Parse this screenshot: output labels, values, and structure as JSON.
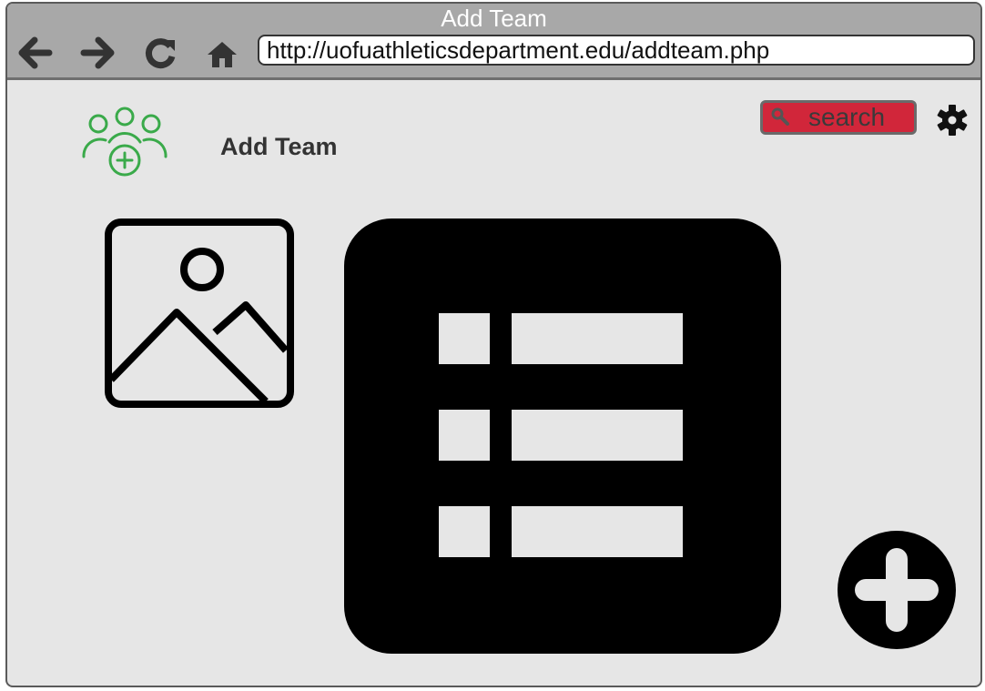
{
  "browser": {
    "window_title": "Add Team",
    "url": "http://uofuathleticsdepartment.edu/addteam.php",
    "nav_icons": [
      "back-arrow-icon",
      "forward-arrow-icon",
      "reload-icon",
      "home-icon"
    ]
  },
  "header": {
    "title": "Add Team",
    "logo_icon": "team-add-icon",
    "logo_color": "#3aaa4a"
  },
  "search": {
    "placeholder": "search",
    "background_color": "#d1263a",
    "icon": "search-icon"
  },
  "settings": {
    "icon": "gear-icon"
  },
  "main": {
    "image_placeholder_icon": "image-icon",
    "list_icon": "list-icon",
    "list_rows": 3,
    "add_icon": "add-circle-icon"
  }
}
